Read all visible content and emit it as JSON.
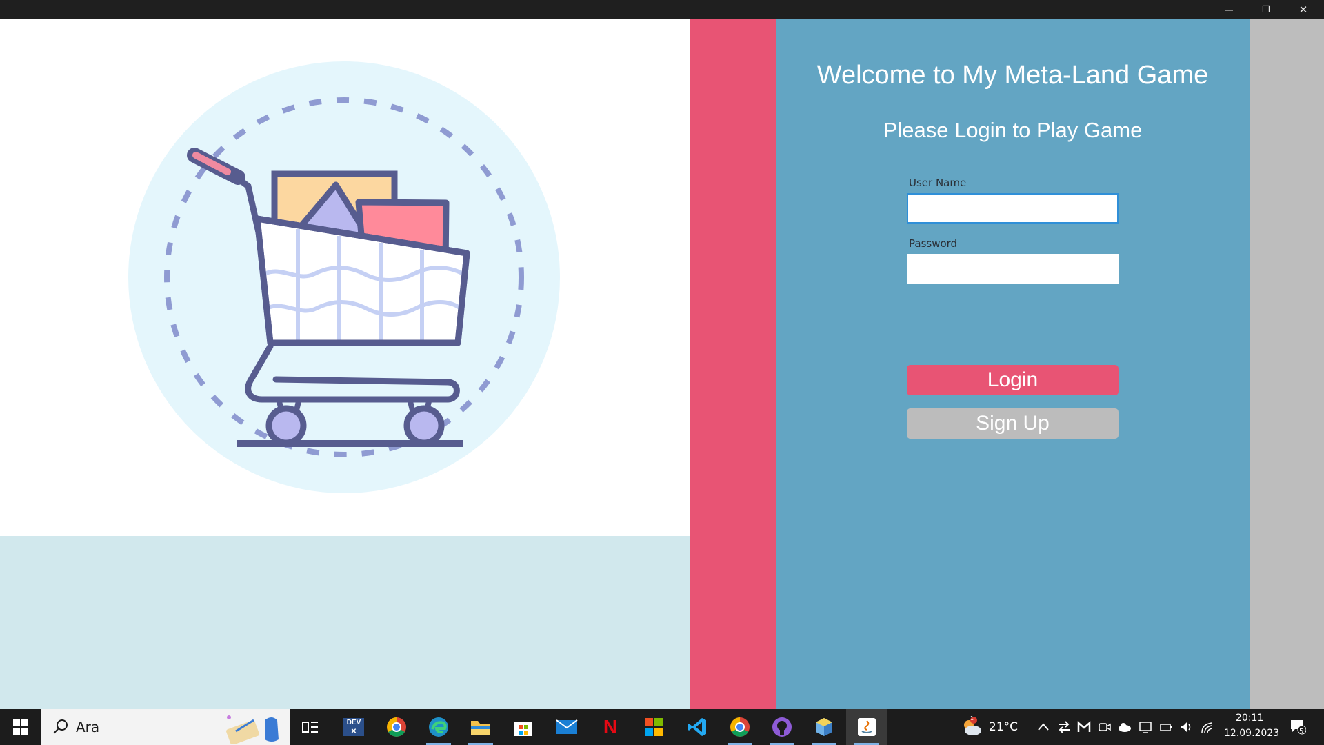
{
  "window": {
    "minimize_glyph": "—",
    "restore_glyph": "❐",
    "close_glyph": "✕"
  },
  "login": {
    "welcome": "Welcome to My Meta-Land Game",
    "subtitle": "Please Login to Play Game",
    "username_label": "User Name",
    "username_value": "",
    "password_label": "Password",
    "password_value": "",
    "login_button": "Login",
    "signup_button": "Sign Up"
  },
  "colors": {
    "accent_pink": "#e85474",
    "panel_blue": "#63a5c3",
    "panel_gray": "#bdbdbd",
    "bottom_left": "#d1e8ed",
    "illustration_circle": "#e4f6fc",
    "cart_outline": "#575c8f"
  },
  "illustration": {
    "icon": "shopping-cart-icon"
  },
  "taskbar": {
    "search_placeholder": "Ara",
    "apps": [
      {
        "name": "task-view-icon"
      },
      {
        "name": "devexpress-icon",
        "label": "DEV"
      },
      {
        "name": "chrome-icon"
      },
      {
        "name": "edge-icon"
      },
      {
        "name": "file-explorer-icon"
      },
      {
        "name": "microsoft-store-icon"
      },
      {
        "name": "mail-icon"
      },
      {
        "name": "netflix-icon",
        "label": "N"
      },
      {
        "name": "office-icon"
      },
      {
        "name": "vscode-icon"
      },
      {
        "name": "chrome-icon"
      },
      {
        "name": "github-desktop-icon"
      },
      {
        "name": "virtualbox-icon"
      },
      {
        "name": "java-icon"
      }
    ],
    "weather_badge": "1",
    "weather_temp": "21°C",
    "time": "20:11",
    "date": "12.09.2023",
    "notification_count": "5"
  }
}
